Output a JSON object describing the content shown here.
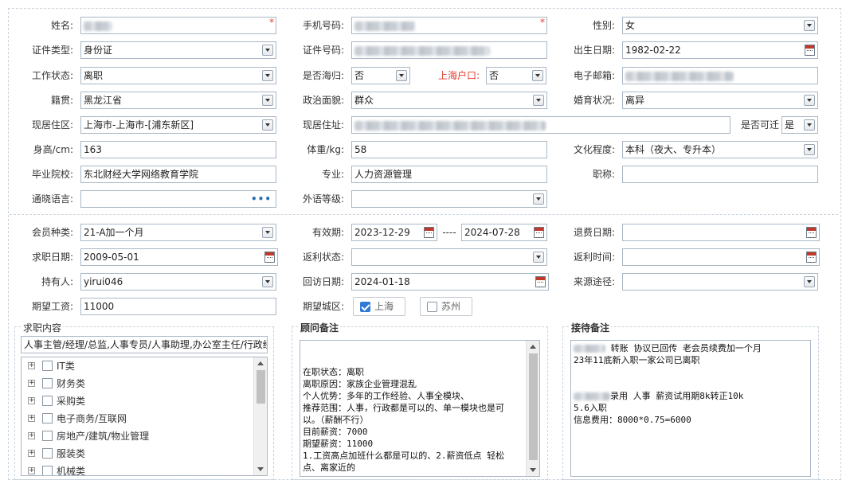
{
  "personal": {
    "name_label": "姓名:",
    "phone_label": "手机号码:",
    "gender_label": "性别:",
    "gender_value": "女",
    "idtype_label": "证件类型:",
    "idtype_value": "身份证",
    "idno_label": "证件号码:",
    "birth_label": "出生日期:",
    "birth_value": "1982-02-22",
    "workstatus_label": "工作状态:",
    "workstatus_value": "离职",
    "returnee_label": "是否海归:",
    "returnee_value": "否",
    "shanghai_hukou_label": "上海户口:",
    "shanghai_hukou_value": "否",
    "email_label": "电子邮箱:",
    "native_label": "籍贯:",
    "native_value": "黑龙江省",
    "political_label": "政治面貌:",
    "political_value": "群众",
    "marital_label": "婚育状况:",
    "marital_value": "离异",
    "current_area_label": "现居住区:",
    "current_area_value": "上海市-上海市-[浦东新区]",
    "current_addr_label": "现居住址:",
    "relocate_label": "是否可迁",
    "relocate_value": "是",
    "height_label": "身高/cm:",
    "height_value": "163",
    "weight_label": "体重/kg:",
    "weight_value": "58",
    "education_label": "文化程度:",
    "education_value": "本科（夜大、专升本）",
    "school_label": "毕业院校:",
    "school_value": "东北财经大学网络教育学院",
    "major_label": "专业:",
    "major_value": "人力资源管理",
    "title_label": "职称:",
    "dialect_label": "通晓语言:",
    "dialect_button": "•••",
    "foreign_label": "外语等级:",
    "required_mark": "*"
  },
  "membership": {
    "type_label": "会员种类:",
    "type_value": "21-A加一个月",
    "valid_label": "有效期:",
    "valid_from": "2023-12-29",
    "valid_sep": "----",
    "valid_to": "2024-07-28",
    "refund_date_label": "退费日期:",
    "job_date_label": "求职日期:",
    "job_date_value": "2009-05-01",
    "rebate_status_label": "返利状态:",
    "rebate_time_label": "返利时间:",
    "holder_label": "持有人:",
    "holder_value": "yirui046",
    "visit_date_label": "回访日期:",
    "visit_date_value": "2024-01-18",
    "source_label": "来源途径:",
    "salary_label": "期望工资:",
    "salary_value": "11000",
    "city_label": "期望城区:",
    "city_options": [
      {
        "label": "上海",
        "checked": true
      },
      {
        "label": "苏州",
        "checked": false
      }
    ]
  },
  "job_content": {
    "title": "求职内容",
    "summary": "人事主管/经理/总监,人事专员/人事助理,办公室主任/行政经",
    "tree": [
      "IT类",
      "财务类",
      "采购类",
      "电子商务/互联网",
      "房地产/建筑/物业管理",
      "服装类",
      "机械类"
    ]
  },
  "consultant_note": {
    "title": "顾问备注",
    "lines": [
      "",
      "",
      "在职状态：离职",
      "离职原因：家族企业管理混乱",
      "个人优势：多年的工作经验、人事全模块、",
      "推荐范围：人事，行政都是可以的、单一模块也是可",
      "以。（薪酬不行）",
      "目前薪资：7000",
      "期望薪资：11000",
      "1.工资高点加班什么都是可以的、2.薪资低点 轻松",
      "点、离家近的"
    ]
  },
  "reception_note": {
    "title": "接待备注",
    "lines": [
      " 转账 协议已回传 老会员续费加一个月",
      "23年11底新入职一家公司已离职",
      "",
      "",
      "录用 人事 薪资试用期8k转正10k",
      "5.6入职",
      "信息费用：8000*0.75=6000"
    ]
  }
}
